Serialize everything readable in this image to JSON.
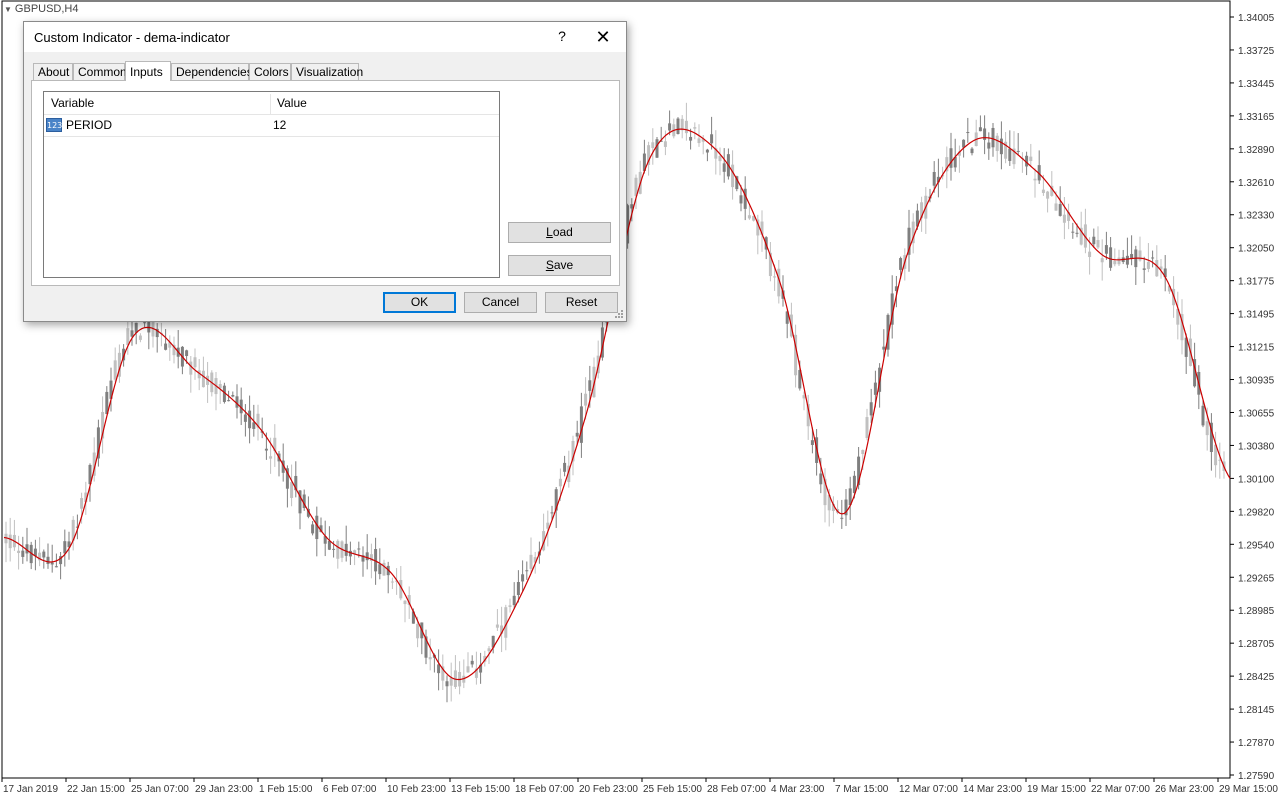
{
  "chart": {
    "symbol": "GBPUSD,H4",
    "price_labels": [
      "1.34005",
      "1.33725",
      "1.33445",
      "1.33165",
      "1.32890",
      "1.32610",
      "1.32330",
      "1.32050",
      "1.31775",
      "1.31495",
      "1.31215",
      "1.30935",
      "1.30655",
      "1.30380",
      "1.30100",
      "1.29820",
      "1.29540",
      "1.29265",
      "1.28985",
      "1.28705",
      "1.28425",
      "1.28145",
      "1.27870",
      "1.27590"
    ],
    "time_labels": [
      "17 Jan 2019",
      "22 Jan 15:00",
      "25 Jan 07:00",
      "29 Jan 23:00",
      "1 Feb 15:00",
      "6 Feb 07:00",
      "10 Feb 23:00",
      "13 Feb 15:00",
      "18 Feb 07:00",
      "20 Feb 23:00",
      "25 Feb 15:00",
      "28 Feb 07:00",
      "4 Mar 23:00",
      "7 Mar 15:00",
      "12 Mar 07:00",
      "14 Mar 23:00",
      "19 Mar 15:00",
      "22 Mar 07:00",
      "26 Mar 23:00",
      "29 Mar 15:00"
    ],
    "candle_color": "#7f7f7f",
    "candle_light_color": "#c0c0c0",
    "indicator_color": "#cc0000"
  },
  "chart_data": {
    "type": "line",
    "series": [
      {
        "x": [
          "17 Jan 2019",
          "22 Jan 15:00",
          "25 Jan 07:00",
          "29 Jan 23:00",
          "1 Feb 15:00",
          "6 Feb 07:00",
          "10 Feb 23:00",
          "13 Feb 15:00",
          "18 Feb 07:00",
          "20 Feb 23:00",
          "25 Feb 15:00",
          "28 Feb 07:00",
          "4 Mar 23:00",
          "7 Mar 15:00",
          "12 Mar 07:00",
          "14 Mar 23:00",
          "19 Mar 15:00",
          "22 Mar 07:00",
          "26 Mar 23:00",
          "29 Mar 15:00"
        ],
        "values": [
          1.296,
          1.295,
          1.313,
          1.31,
          1.305,
          1.296,
          1.293,
          1.284,
          1.291,
          1.306,
          1.328,
          1.329,
          1.318,
          1.298,
          1.32,
          1.3295,
          1.327,
          1.32,
          1.318,
          1.301
        ]
      }
    ],
    "ylim": [
      1.2759,
      1.34005
    ]
  },
  "dialog": {
    "title": "Custom Indicator - dema-indicator",
    "help_glyph": "?",
    "close_glyph": "✕",
    "tabs": [
      {
        "label": "About"
      },
      {
        "label": "Common"
      },
      {
        "label": "Inputs"
      },
      {
        "label": "Dependencies"
      },
      {
        "label": "Colors"
      },
      {
        "label": "Visualization"
      }
    ],
    "grid": {
      "col_variable": "Variable",
      "col_value": "Value",
      "row_icon": "123",
      "rows": [
        {
          "variable": "PERIOD",
          "value": "12"
        }
      ]
    },
    "buttons": {
      "load": {
        "first": "L",
        "rest": "oad"
      },
      "save": {
        "first": "S",
        "rest": "ave"
      },
      "ok": "OK",
      "cancel": "Cancel",
      "reset": "Reset"
    }
  }
}
